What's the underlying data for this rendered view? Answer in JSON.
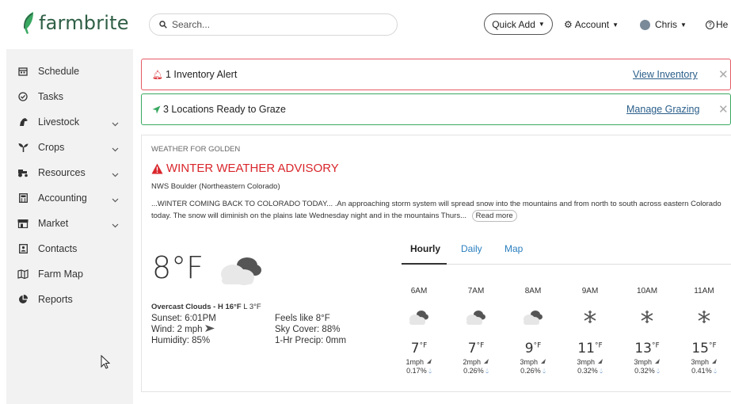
{
  "brand": {
    "name": "farmbrite",
    "color": "#2f5f45",
    "accent": "#3aa861"
  },
  "header": {
    "search_placeholder": "Search...",
    "quick_add": "Quick Add",
    "account": "Account",
    "user": "Chris",
    "help": "He"
  },
  "sidebar": {
    "items": [
      {
        "label": "Schedule",
        "icon": "calendar-icon"
      },
      {
        "label": "Tasks",
        "icon": "check-circle-icon"
      },
      {
        "label": "Livestock",
        "icon": "horse-icon"
      },
      {
        "label": "Crops",
        "icon": "seedling-icon"
      },
      {
        "label": "Resources",
        "icon": "tractor-icon"
      },
      {
        "label": "Accounting",
        "icon": "calculator-icon"
      },
      {
        "label": "Market",
        "icon": "store-icon"
      },
      {
        "label": "Contacts",
        "icon": "address-book-icon"
      },
      {
        "label": "Farm Map",
        "icon": "map-icon"
      },
      {
        "label": "Reports",
        "icon": "pie-chart-icon"
      }
    ]
  },
  "alerts": {
    "inventory": {
      "text": "1 Inventory Alert",
      "link": "View Inventory",
      "color": "#e45a64"
    },
    "graze": {
      "text": "3 Locations Ready to Graze",
      "link": "Manage Grazing",
      "color": "#3aa861"
    }
  },
  "weather": {
    "title": "WEATHER FOR GOLDEN",
    "advisory": "WINTER WEATHER ADVISORY",
    "source": "NWS Boulder (Northeastern Colorado)",
    "advisory_text": "...WINTER COMING BACK TO COLORADO TODAY... .An approaching storm system will spread snow into the mountains and from north to south across eastern Colorado today. The snow will diminish on the plains late Wednesday night and in the mountains Thurs...",
    "read_more": "Read more",
    "current_temp": "8°F",
    "summary_cond": "Overcast Clouds",
    "summary_high": "H 16°F",
    "summary_low": "L 3°F",
    "sunset": "Sunset: 6:01PM",
    "wind": "Wind: 2 mph",
    "humidity": "Humidity: 85%",
    "feels_like": "Feels like 8°F",
    "sky_cover": "Sky Cover: 88%",
    "precip": "1-Hr Precip: 0mm",
    "tabs": {
      "hourly": "Hourly",
      "daily": "Daily",
      "map": "Map"
    },
    "hours": [
      {
        "time": "6AM",
        "icon": "cloud-icon",
        "temp": "7",
        "wind": "1mph",
        "precip": "0.17%"
      },
      {
        "time": "7AM",
        "icon": "cloud-icon",
        "temp": "7",
        "wind": "2mph",
        "precip": "0.26%"
      },
      {
        "time": "8AM",
        "icon": "cloud-icon",
        "temp": "9",
        "wind": "3mph",
        "precip": "0.26%"
      },
      {
        "time": "9AM",
        "icon": "snowflake-icon",
        "temp": "11",
        "wind": "3mph",
        "precip": "0.32%"
      },
      {
        "time": "10AM",
        "icon": "snowflake-icon",
        "temp": "13",
        "wind": "3mph",
        "precip": "0.32%"
      },
      {
        "time": "11AM",
        "icon": "snowflake-icon",
        "temp": "15",
        "wind": "3mph",
        "precip": "0.41%"
      }
    ]
  }
}
